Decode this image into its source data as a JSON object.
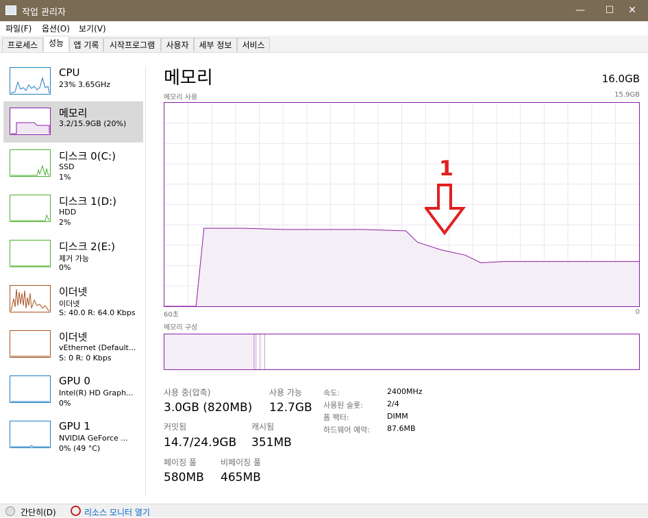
{
  "window": {
    "title": "작업 관리자",
    "minimize": "—",
    "maximize": "☐",
    "close": "✕"
  },
  "menu": [
    "파일(F)",
    "옵션(O)",
    "보기(V)"
  ],
  "tabs": [
    "프로세스",
    "성능",
    "앱 기록",
    "시작프로그램",
    "사용자",
    "세부 정보",
    "서비스"
  ],
  "active_tab": "성능",
  "sidebar": [
    {
      "title": "CPU",
      "sub1": "23% 3.65GHz",
      "sub2": "",
      "color": "#1c7cbf"
    },
    {
      "title": "메모리",
      "sub1": "3.2/15.9GB (20%)",
      "sub2": "",
      "color": "#8b1ba5"
    },
    {
      "title": "디스크 0(C:)",
      "sub1": "SSD",
      "sub2": "1%",
      "color": "#4caf2e"
    },
    {
      "title": "디스크 1(D:)",
      "sub1": "HDD",
      "sub2": "2%",
      "color": "#4caf2e"
    },
    {
      "title": "디스크 2(E:)",
      "sub1": "제거 가능",
      "sub2": "0%",
      "color": "#4caf2e"
    },
    {
      "title": "이더넷",
      "sub1": "이더넷",
      "sub2": "S: 40.0  R: 64.0 Kbps",
      "color": "#a5511b"
    },
    {
      "title": "이더넷",
      "sub1": "vEthernet (Default...",
      "sub2": "S: 0  R: 0 Kbps",
      "color": "#a5511b"
    },
    {
      "title": "GPU 0",
      "sub1": "Intel(R) HD Graph...",
      "sub2": "0%",
      "color": "#1c7cbf"
    },
    {
      "title": "GPU 1",
      "sub1": "NVIDIA GeForce ...",
      "sub2": "0% (49 °C)",
      "color": "#1c7cbf"
    }
  ],
  "main": {
    "title": "메모리",
    "capacity": "16.0GB",
    "usage_label": "메모리 사용",
    "usage_max": "15.9GB",
    "x_left": "60초",
    "x_right": "0",
    "composition_label": "메모리 구성",
    "annotation": "1"
  },
  "stats": {
    "in_use_label": "사용 중(압축)",
    "in_use_value": "3.0GB (820MB)",
    "available_label": "사용 가능",
    "available_value": "12.7GB",
    "committed_label": "커밋됨",
    "committed_value": "14.7/24.9GB",
    "cached_label": "캐시됨",
    "cached_value": "351MB",
    "paged_label": "페이징 풀",
    "paged_value": "580MB",
    "nonpaged_label": "비페이징 풀",
    "nonpaged_value": "465MB"
  },
  "specs": [
    {
      "label": "속도:",
      "value": "2400MHz"
    },
    {
      "label": "사용된 슬롯:",
      "value": "2/4"
    },
    {
      "label": "폼 팩터:",
      "value": "DIMM"
    },
    {
      "label": "하드웨어 예약:",
      "value": "87.6MB"
    }
  ],
  "footer": {
    "simple": "간단히(D)",
    "resmon": "리소스 모니터 열기"
  },
  "chart_data": {
    "type": "area",
    "title": "메모리 사용",
    "x_label_left": "60초",
    "x_label_right": "0",
    "ylim": [
      0,
      15.9
    ],
    "y_unit": "GB",
    "x": [
      60,
      56,
      55,
      50,
      45,
      40,
      35,
      30,
      29.5,
      28,
      25,
      22,
      20,
      17,
      15,
      10,
      5,
      0
    ],
    "values": [
      0,
      0,
      6.1,
      6.1,
      6.0,
      6.0,
      6.0,
      5.9,
      5.9,
      5.0,
      4.4,
      4.0,
      3.4,
      3.5,
      3.5,
      3.5,
      3.5,
      3.5
    ]
  }
}
